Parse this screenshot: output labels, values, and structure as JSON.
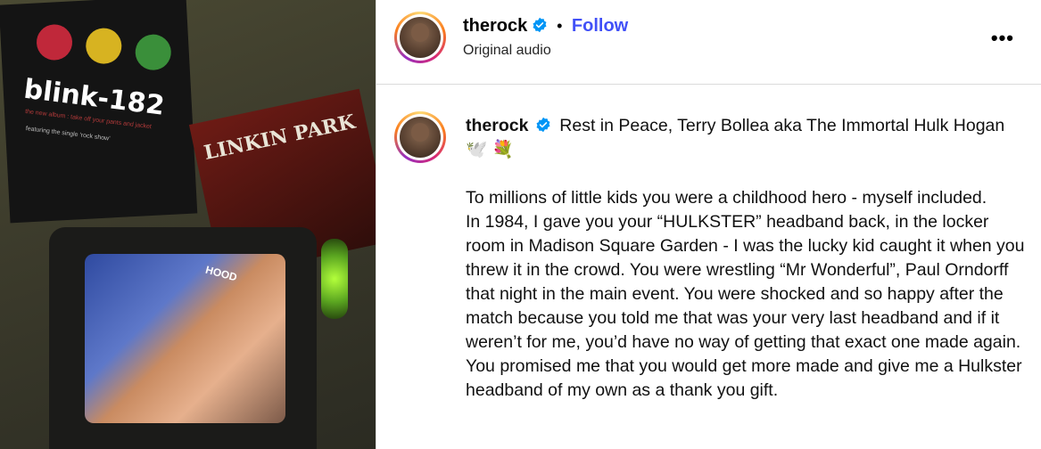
{
  "media": {
    "poster_left_text": "blink-182",
    "poster_left_sub": "the new album : take off your pants and jacket",
    "poster_left_sub2": "featuring the single 'rock show'",
    "poster_right_text": "LINKIN PARK",
    "screen_text": "HOOD"
  },
  "header": {
    "username": "therock",
    "dot": "•",
    "follow_label": "Follow",
    "audio": "Original audio",
    "more_label": "•••"
  },
  "caption": {
    "username": "therock",
    "first_line": "Rest in Peace, Terry Bollea aka The Immortal Hulk Hogan",
    "emojis": "🕊️ 💐",
    "paragraph1": "To millions of little kids you were a childhood hero - myself included.",
    "paragraph2": "In 1984, I gave you your “HULKSTER” headband back, in the locker room in Madison Square Garden - I was the lucky kid caught it when you threw it in the crowd. You were wrestling “Mr Wonderful”, Paul Orndorff that night in the main event. You were shocked and so happy after the match because you told me that was your very last headband and if it weren’t for me, you’d have no way of getting that exact one made again. You promised me that you would get more made and give me a Hulkster headband of my own as a thank you gift."
  },
  "colors": {
    "follow": "#4150f7",
    "verified": "#0095f6",
    "divider": "#dbdbdb"
  }
}
